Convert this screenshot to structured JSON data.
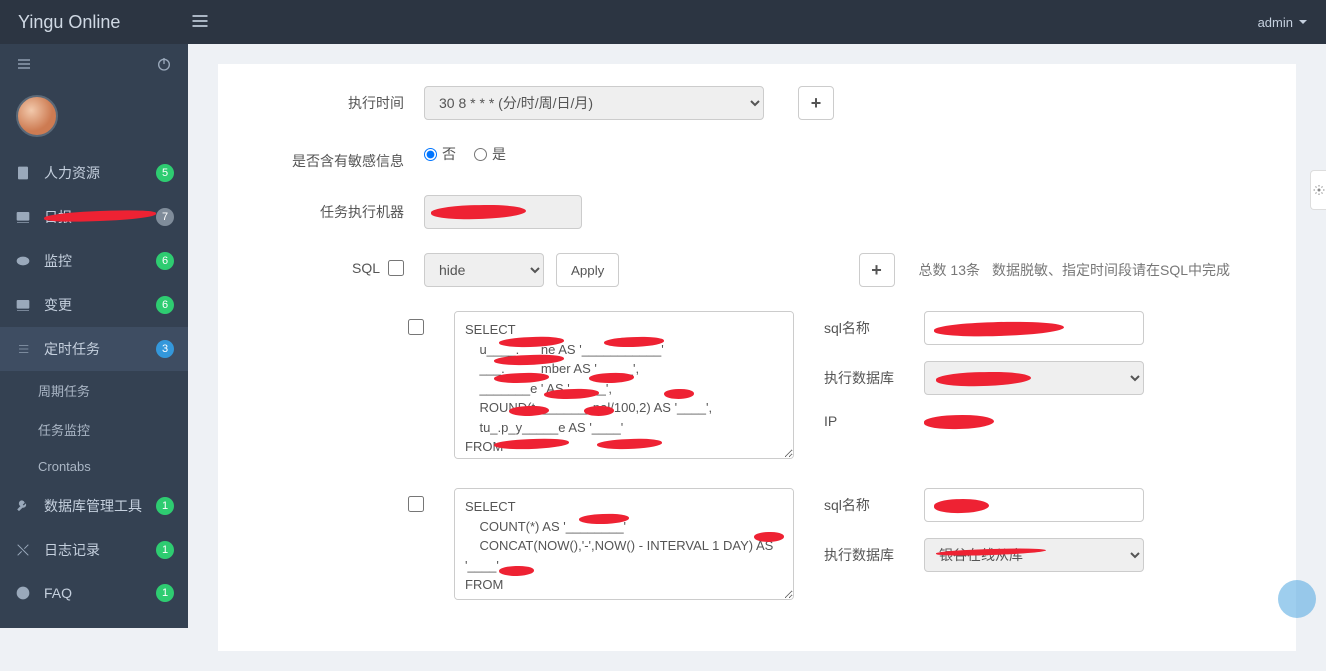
{
  "header": {
    "brand": "Yingu Online",
    "user": "admin"
  },
  "sidebar": {
    "items": [
      {
        "icon": "file",
        "label": "人力资源",
        "badge": "5"
      },
      {
        "icon": "monitor",
        "label": "日报",
        "badge": "7",
        "redacted": true
      },
      {
        "icon": "eye",
        "label": "监控",
        "badge": "6"
      },
      {
        "icon": "monitor",
        "label": "变更",
        "badge": "6"
      },
      {
        "icon": "list",
        "label": "定时任务",
        "badge": "3",
        "active": true
      },
      {
        "icon": "wrench",
        "label": "数据库管理工具",
        "badge": "1"
      },
      {
        "icon": "tools",
        "label": "日志记录",
        "badge": "1"
      },
      {
        "icon": "info",
        "label": "FAQ",
        "badge": "1"
      }
    ],
    "subs": [
      "周期任务",
      "任务监控",
      "Crontabs"
    ]
  },
  "form": {
    "exec_time_label": "执行时间",
    "exec_time_value": "30 8 * * * (分/时/周/日/月)",
    "sensitive_label": "是否含有敏感信息",
    "sensitive_no": "否",
    "sensitive_yes": "是",
    "executor_label": "任务执行机器",
    "sql_label": "SQL",
    "hide_opt": "hide",
    "apply_btn": "Apply",
    "count_text": "总数 13条",
    "hint": "数据脱敏、指定时间段请在SQL中完成"
  },
  "blocks": [
    {
      "sql_text": "SELECT\n    u____.___ne AS '___________'\n    ___._____mber AS '_____',\n    _______e ' AS '_____',\n    ROUND(t________pal/100,2) AS '____',\n    tu_.p_y_____e AS '____'\nFROM\n    _____________._r_buy_si______________r LEFT JOIN\n    ____________________________ ON",
      "name_label": "sql名称",
      "db_label": "执行数据库",
      "ip_label": "IP"
    },
    {
      "sql_text": "SELECT\n    COUNT(*) AS '________'\n    CONCAT(NOW(),'-',NOW() - INTERVAL 1 DAY) AS '____'\nFROM\n    j_____r_user_info\nWHERE",
      "name_label": "sql名称",
      "db_label": "执行数据库",
      "db_value": "银谷在线从库"
    }
  ]
}
